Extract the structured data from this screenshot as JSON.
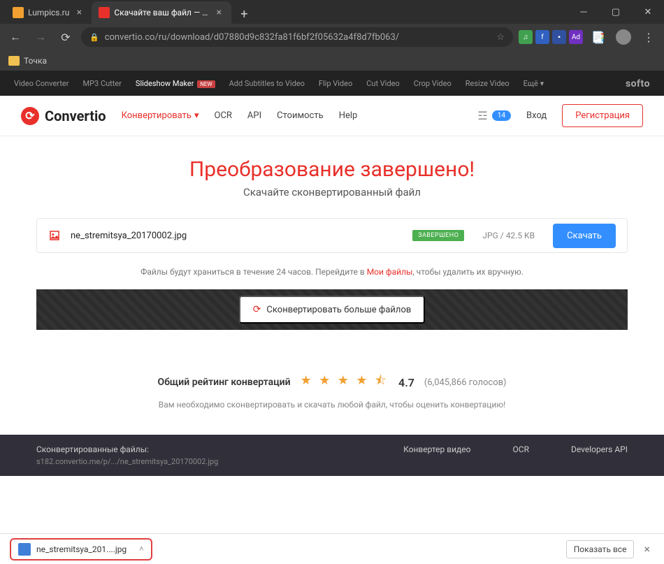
{
  "browser": {
    "tabs": [
      {
        "title": "Lumpics.ru",
        "favicon_bg": "#f0a030"
      },
      {
        "title": "Скачайте ваш файл — Convertio",
        "favicon_bg": "#e9302a"
      }
    ],
    "url": "convertio.co/ru/download/d07880d9c832fa81f6bf2f05632a4f8d7fb063/",
    "bookmark": "Точка"
  },
  "toolbar": {
    "items": [
      "Video Converter",
      "MP3 Cutter",
      "Slideshow Maker",
      "Add Subtitles to Video",
      "Flip Video",
      "Cut Video",
      "Crop Video",
      "Resize Video",
      "Ещё"
    ],
    "new_label": "NEW",
    "brand": "softo"
  },
  "nav": {
    "logo": "Convertio",
    "items": [
      "Конвертировать",
      "OCR",
      "API",
      "Стоимость",
      "Help"
    ],
    "badge_count": "14",
    "login": "Вход",
    "register": "Регистрация"
  },
  "main": {
    "title": "Преобразование завершено!",
    "subtitle": "Скачайте сконвертированный файл",
    "file": {
      "name": "ne_stremitsya_20170002.jpg",
      "status": "ЗАВЕРШЕНО",
      "format": "JPG",
      "size": "42.5 KB"
    },
    "download": "Скачать",
    "note_pre": "Файлы будут храниться в течение 24 часов. Перейдите в ",
    "note_link": "Мои файлы",
    "note_post": ", чтобы удалить их вручную.",
    "more": "Сконвертировать больше файлов"
  },
  "rating": {
    "label": "Общий рейтинг конвертаций",
    "stars": "★ ★ ★ ★ ⯪",
    "score": "4.7",
    "count": "(6,045,866 голосов)",
    "note": "Вам необходимо сконвертировать и скачать любой файл, чтобы оценить конвертацию!"
  },
  "footer": {
    "converted": "Сконвертированные файлы:",
    "link": "s182.convertio.me/p/.../ne_stremitsya_20170002.jpg",
    "col1": "Конвертер видео",
    "col2": "OCR",
    "col3": "Developers API"
  },
  "downloads": {
    "item": "ne_stremitsya_201....jpg",
    "showall": "Показать все"
  }
}
